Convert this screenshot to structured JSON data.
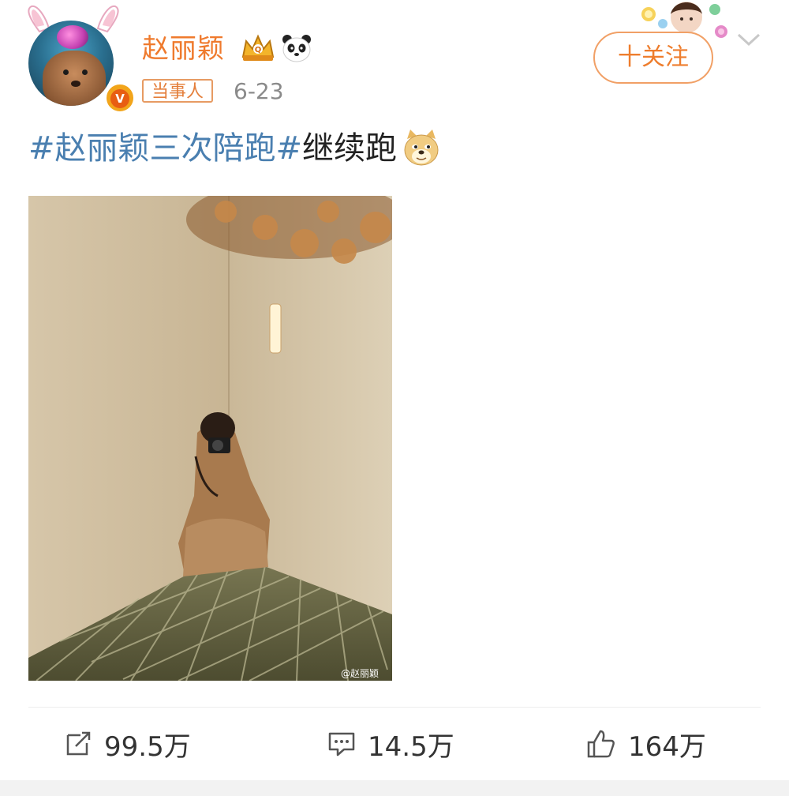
{
  "post": {
    "author": "赵丽颖",
    "tag": "当事人",
    "date": "6-23",
    "follow_label": "十关注",
    "hashtag1": "#赵丽颖三次陪跑#",
    "text_tail": "继续跑",
    "watermark": "@赵丽颖"
  },
  "stats": {
    "reposts": "99.5万",
    "comments": "14.5万",
    "likes": "164万"
  },
  "icons": {
    "avatar_badge": "verified-v-icon",
    "crown": "crown-icon",
    "panda": "panda-icon",
    "chevron": "chevron-down-icon",
    "doge": "doge-emoji-icon",
    "repost": "repost-icon",
    "comment": "comment-icon",
    "like": "thumbs-up-icon"
  },
  "colors": {
    "accent": "#ef7a2d",
    "hashtag": "#4a7fb0"
  }
}
